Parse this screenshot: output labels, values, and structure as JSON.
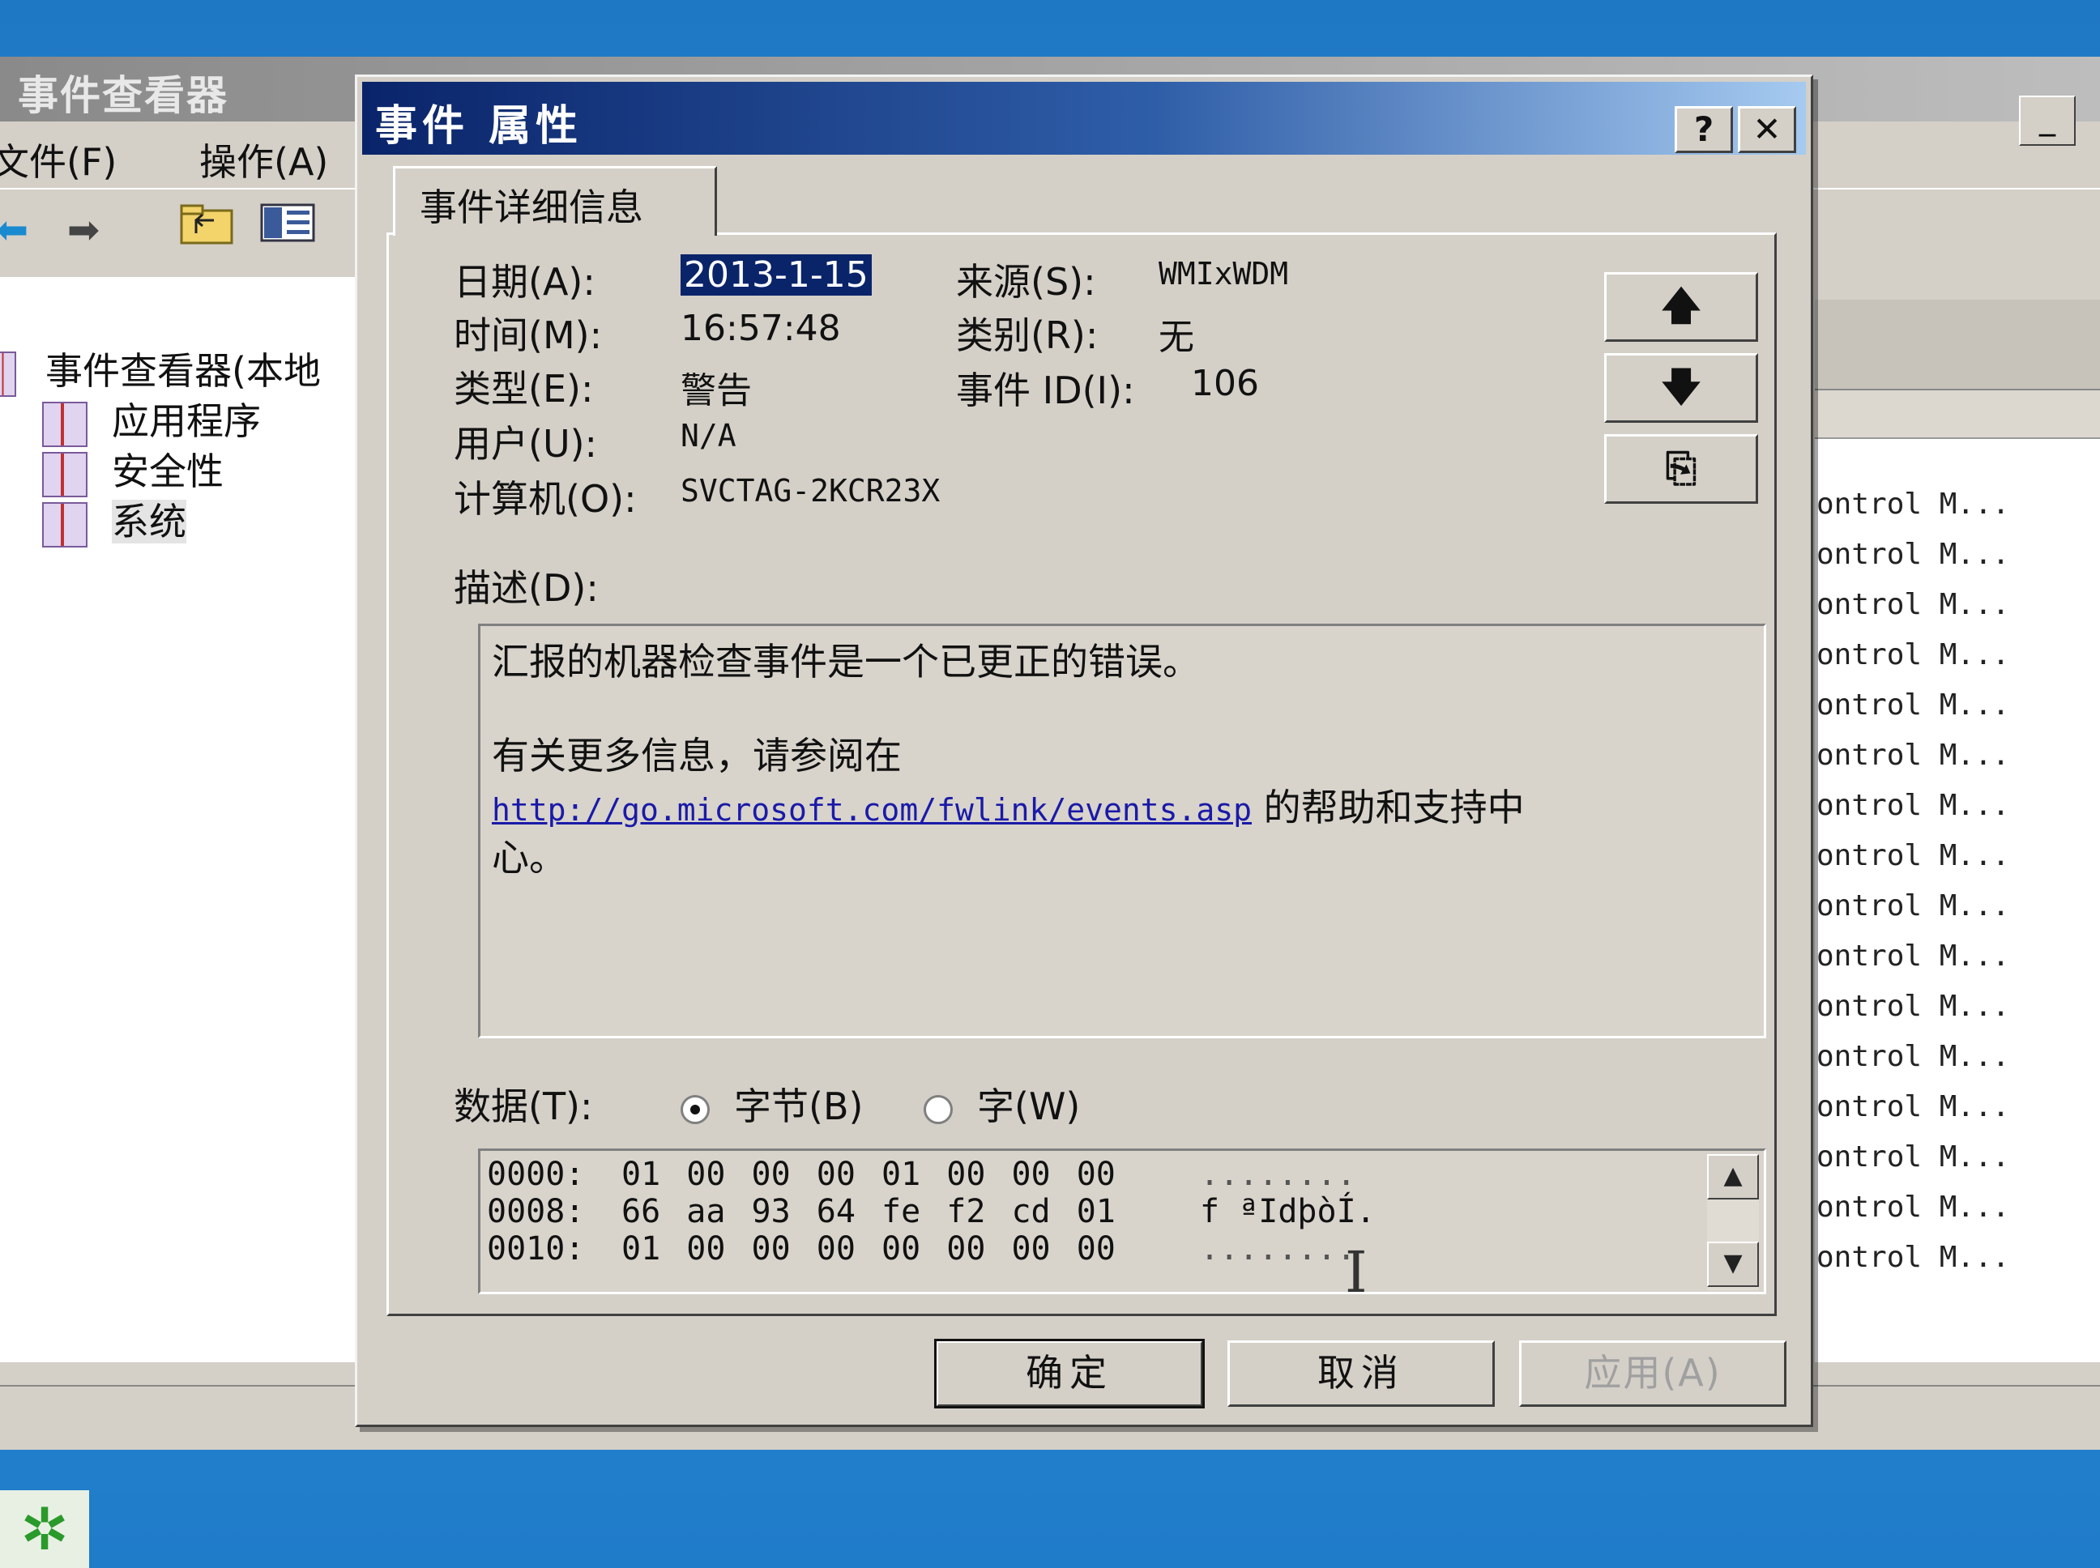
{
  "background_window": {
    "title": "事件查看器",
    "menu": [
      "文件(F)",
      "操作(A)"
    ],
    "toolbar": {
      "back": "⬅",
      "forward": "➡"
    },
    "tree": [
      "事件查看器(本地",
      "应用程序",
      "安全性",
      "系统"
    ],
    "list_rows": [
      "ontrol M...",
      "ontrol M...",
      "ontrol M...",
      "ontrol M...",
      "ontrol M...",
      "ontrol M...",
      "ontrol M...",
      "ontrol M...",
      "ontrol M...",
      "ontrol M...",
      "ontrol M...",
      "ontrol M...",
      "ontrol M...",
      "ontrol M...",
      "ontrol M...",
      "ontrol M..."
    ],
    "minimize": "_"
  },
  "dialog": {
    "title": "事件 属性",
    "help_btn": "?",
    "close_btn": "✕",
    "tab": "事件详细信息",
    "fields": {
      "date_label": "日期(A):",
      "date_value": "2013-1-15",
      "source_label": "来源(S):",
      "source_value": "WMIxWDM",
      "time_label": "时间(M):",
      "time_value": "16:57:48",
      "category_label": "类别(R):",
      "category_value": "无",
      "type_label": "类型(E):",
      "type_value": "警告",
      "eventid_label": "事件 ID(I):",
      "eventid_value": "106",
      "user_label": "用户(U):",
      "user_value": "N/A",
      "computer_label": "计算机(O):",
      "computer_value": "SVCTAG-2KCR23X"
    },
    "nav": {
      "up": "🡅",
      "down": "🡇",
      "copy": "⎘"
    },
    "description_label": "描述(D):",
    "description": {
      "line1": "汇报的机器检查事件是一个已更正的错误。",
      "line2": "有关更多信息，请参阅在",
      "link": "http://go.microsoft.com/fwlink/events.asp",
      "line3_tail": " 的帮助和支持中",
      "line4": "心。"
    },
    "data_label": "数据(T):",
    "radio_bytes": "字节(B)",
    "radio_words": "字(W)",
    "hex_rows": [
      {
        "offset": "0000:",
        "bytes": "01 00 00 00 01 00 00 00",
        "ascii": "........"
      },
      {
        "offset": "0008:",
        "bytes": "66 aa 93 64 fe f2 cd 01",
        "ascii": "f ªIdþòÍ."
      },
      {
        "offset": "0010:",
        "bytes": "01 00 00 00 00 00 00 00",
        "ascii": "........"
      }
    ],
    "scroll_up": "▲",
    "scroll_down": "▼",
    "ok": "确定",
    "cancel": "取消",
    "apply": "应用(A)"
  },
  "cursor": "I"
}
